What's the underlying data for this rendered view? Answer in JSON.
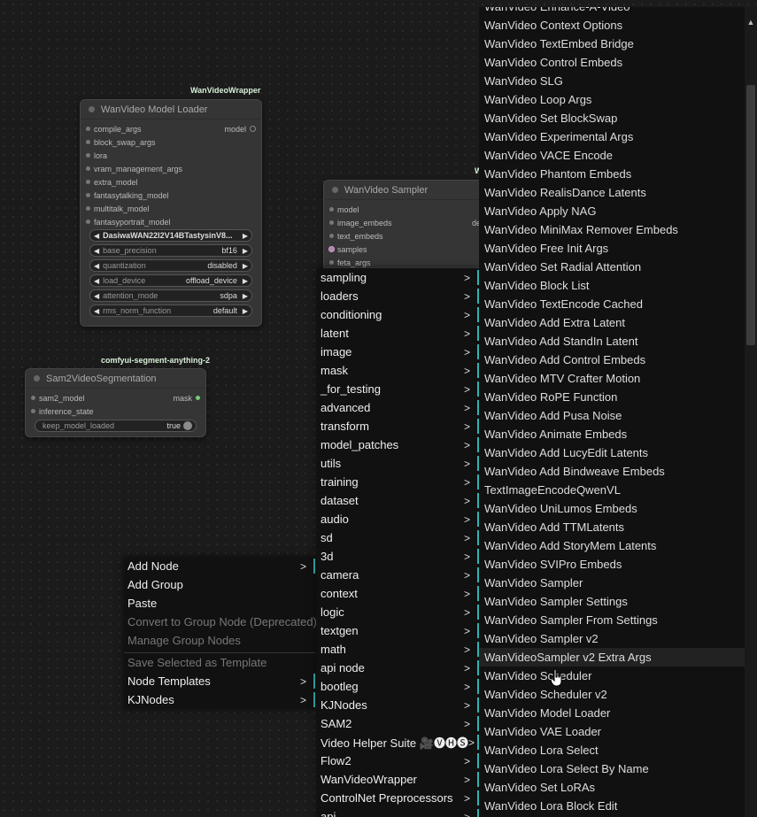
{
  "model_loader": {
    "source": "WanVideoWrapper",
    "title": "WanVideo Model Loader",
    "inputs": [
      "compile_args",
      "block_swap_args",
      "lora",
      "vram_management_args",
      "extra_model",
      "fantasytalking_model",
      "multitalk_model",
      "fantasyportrait_model"
    ],
    "output": "model",
    "combo": "DasiwaWAN22I2V14BTastysinV8...",
    "widgets": [
      {
        "name": "base_precision",
        "value": "bf16"
      },
      {
        "name": "quantization",
        "value": "disabled"
      },
      {
        "name": "load_device",
        "value": "offload_device"
      },
      {
        "name": "attention_mode",
        "value": "sdpa"
      },
      {
        "name": "rms_norm_function",
        "value": "default"
      }
    ]
  },
  "sampler_node": {
    "source": "W",
    "title": "WanVideo Sampler",
    "inputs": [
      "model",
      "image_embeds",
      "text_embeds",
      "samples",
      "feta_args"
    ],
    "output_partial": "den"
  },
  "sam2_node": {
    "source": "comfyui-segment-anything-2",
    "title": "Sam2VideoSegmentation",
    "inputs": [
      "sam2_model",
      "inference_state"
    ],
    "output": "mask",
    "toggle": {
      "name": "keep_model_loaded",
      "value": "true"
    }
  },
  "context_menu": {
    "items": [
      {
        "label": "Add Node",
        "sub": true,
        "disabled": false
      },
      {
        "label": "Add Group",
        "sub": false,
        "disabled": false
      },
      {
        "label": "Paste",
        "sub": false,
        "disabled": false
      },
      {
        "label": "Convert to Group Node (Deprecated)",
        "sub": false,
        "disabled": true
      },
      {
        "label": "Manage Group Nodes",
        "sub": false,
        "disabled": true
      }
    ],
    "items2": [
      {
        "label": "Save Selected as Template",
        "sub": false,
        "disabled": true
      },
      {
        "label": "Node Templates",
        "sub": true,
        "disabled": false
      },
      {
        "label": "KJNodes",
        "sub": true,
        "disabled": false
      }
    ]
  },
  "category_menu": {
    "items": [
      "sampling",
      "loaders",
      "conditioning",
      "latent",
      "image",
      "mask",
      "_for_testing",
      "advanced",
      "transform",
      "model_patches",
      "utils",
      "training",
      "dataset",
      "audio",
      "sd",
      "3d",
      "camera",
      "context",
      "logic",
      "textgen",
      "math",
      "api node",
      "bootleg",
      "KJNodes",
      "SAM2",
      "Video Helper Suite 🎥🅥🅗🅢",
      "Flow2",
      "WanVideoWrapper",
      "ControlNet Preprocessors",
      "api"
    ]
  },
  "node_list": {
    "items": [
      "WanVideo Enhance-A-Video",
      "WanVideo Context Options",
      "WanVideo TextEmbed Bridge",
      "WanVideo Control Embeds",
      "WanVideo SLG",
      "WanVideo Loop Args",
      "WanVideo Set BlockSwap",
      "WanVideo Experimental Args",
      "WanVideo VACE Encode",
      "WanVideo Phantom Embeds",
      "WanVideo RealisDance Latents",
      "WanVideo Apply NAG",
      "WanVideo MiniMax Remover Embeds",
      "WanVideo Free Init Args",
      "WanVideo Set Radial Attention",
      "WanVideo Block List",
      "WanVideo TextEncode Cached",
      "WanVideo Add Extra Latent",
      "WanVideo Add StandIn Latent",
      "WanVideo Add Control Embeds",
      "WanVideo MTV Crafter Motion",
      "WanVideo RoPE Function",
      "WanVideo Add Pusa Noise",
      "WanVideo Animate Embeds",
      "WanVideo Add LucyEdit Latents",
      "WanVideo Add Bindweave Embeds",
      "TextImageEncodeQwenVL",
      "WanVideo UniLumos Embeds",
      "WanVideo Add TTMLatents",
      "WanVideo Add StoryMem Latents",
      "WanVideo SVIPro Embeds",
      "WanVideo Sampler",
      "WanVideo Sampler Settings",
      "WanVideo Sampler From Settings",
      "WanVideo Sampler v2",
      "WanVideoSampler v2 Extra Args",
      "WanVideo Scheduler",
      "WanVideo Scheduler v2",
      "WanVideo Model Loader",
      "WanVideo VAE Loader",
      "WanVideo Lora Select",
      "WanVideo Lora Select By Name",
      "WanVideo Set LoRAs",
      "WanVideo Lora Block Edit"
    ],
    "hovered_index": 35
  },
  "submenu_chevron": ">",
  "scroll_up_icon": "▲",
  "accent_color": "#2fb4b4"
}
